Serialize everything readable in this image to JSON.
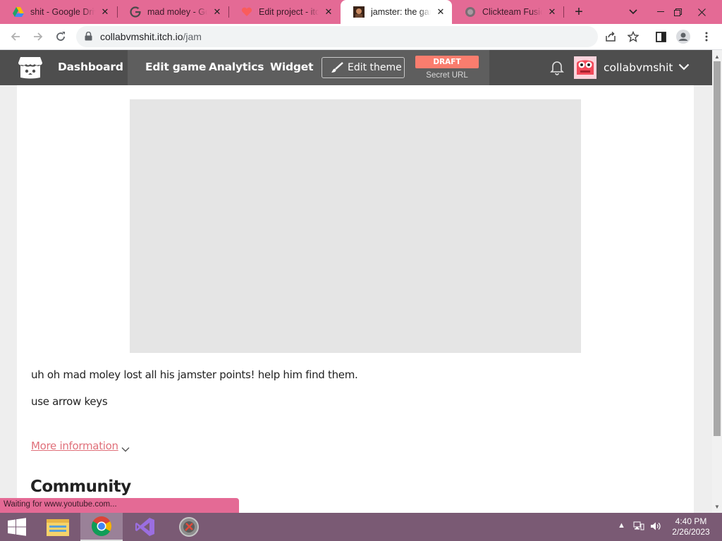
{
  "browser": {
    "tabs": [
      {
        "title": "shit - Google Drive",
        "favicon": "google-drive-icon",
        "active": false
      },
      {
        "title": "mad moley - Google Search",
        "favicon": "google-icon",
        "active": false
      },
      {
        "title": "Edit project - itch.io",
        "favicon": "itch-heart-icon",
        "active": false
      },
      {
        "title": "jamster: the game",
        "favicon": "jamster-icon",
        "active": true
      },
      {
        "title": "Clickteam Fusion",
        "favicon": "globe-icon",
        "active": false
      }
    ],
    "close_glyph": "✕",
    "new_tab_glyph": "+",
    "url_host": "collabvmshit.itch.io",
    "url_path": "/jam"
  },
  "itch": {
    "nav": {
      "dashboard": "Dashboard",
      "edit_game": "Edit game",
      "analytics": "Analytics",
      "widget": "Widget",
      "edit_theme": "Edit theme"
    },
    "draft_badge": "DRAFT",
    "secret_url": "Secret URL",
    "username": "collabvmshit"
  },
  "game": {
    "description_lines": [
      "uh oh mad moley lost all his jamster points! help him find them.",
      "use arrow keys"
    ],
    "more_information": "More information",
    "community_heading": "Community"
  },
  "status_bubble": "Waiting for www.youtube.com...",
  "taskbar": {
    "apps": [
      "start-button",
      "file-explorer-icon",
      "chrome-icon",
      "visual-studio-icon",
      "clickteam-icon"
    ],
    "time": "4:40 PM",
    "date": "2/26/2023"
  },
  "colors": {
    "tab_strip": "#e46a95",
    "itch_header": "#4e4e4e",
    "draft_badge": "#fa7d6e",
    "link": "#e0707a",
    "taskbar": "#7a5a74"
  }
}
